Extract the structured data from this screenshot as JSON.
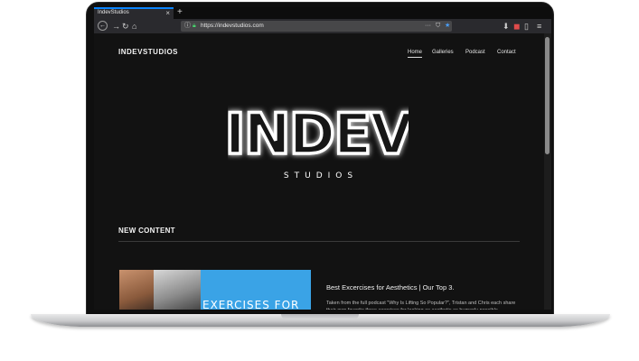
{
  "browser": {
    "tab_title": "IndevStudios",
    "tab_close": "×",
    "new_tab": "+",
    "url_prefix": "https://",
    "url_domain": "indevstudios.com",
    "url_full": "https://indevstudios.com",
    "more_dots": "···"
  },
  "site": {
    "brand": "INDEVSTUDIOS",
    "nav": [
      {
        "label": "Home",
        "active": true
      },
      {
        "label": "Galleries"
      },
      {
        "label": "Podcast"
      },
      {
        "label": "Contact"
      }
    ],
    "logo": {
      "main": "INDEV",
      "sub": "STUDIOS"
    },
    "section_title": "NEW CONTENT",
    "post": {
      "title": "Best Excercises for Aesthetics | Our Top 3.",
      "excerpt": "Taken from the full podcast \"Why Is Lifting So Popular?\", Tristan and Chris each share their own favorite three exercises for looking as aesthetic as humanly possible.",
      "thumb_text": "EXERCISES FOR"
    }
  },
  "colors": {
    "accent_tab": "#0a84ff",
    "thumb_bg": "#3aa3e6",
    "page_bg": "#121212"
  }
}
